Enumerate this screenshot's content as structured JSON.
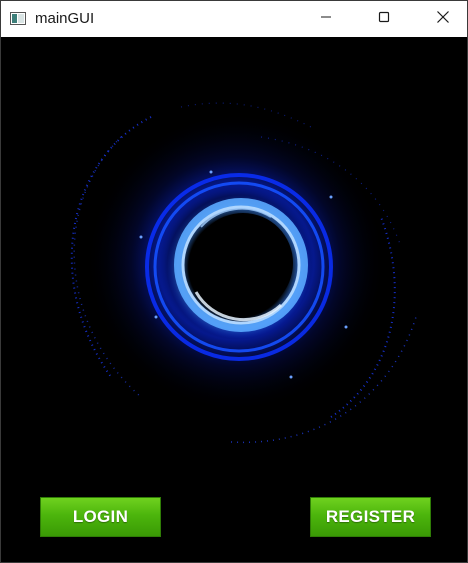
{
  "window": {
    "title": "mainGUI",
    "icon": "app-window-icon",
    "controls": {
      "minimize_icon": "minimize-icon",
      "maximize_icon": "maximize-icon",
      "close_icon": "close-icon"
    }
  },
  "main": {
    "graphic": "blue-portal-ring",
    "buttons": {
      "login_label": "LOGIN",
      "register_label": "REGISTER"
    }
  },
  "colors": {
    "button_green": "#4cb50c",
    "portal_blue": "#1e5bff",
    "background": "#000000"
  }
}
